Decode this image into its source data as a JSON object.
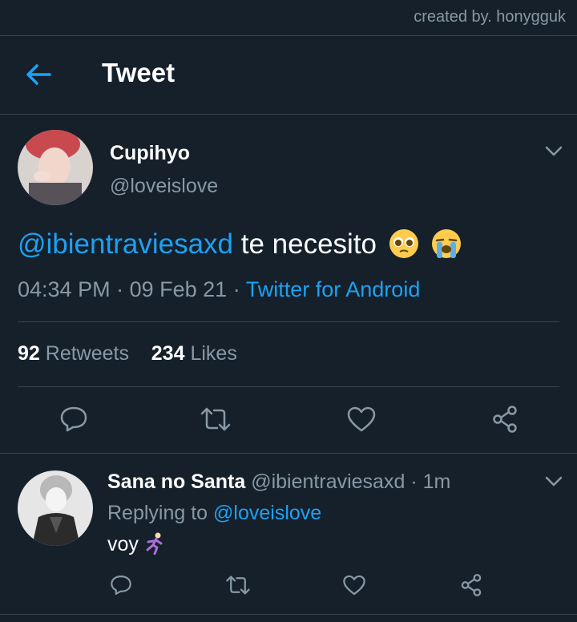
{
  "credit": "created by. honygguk",
  "header": {
    "title": "Tweet",
    "back_icon": "arrow-left-icon"
  },
  "tweet": {
    "author_name": "Cupihyo",
    "author_handle": "@loveislove",
    "mention": "@ibientraviesaxd",
    "text": "te necesito",
    "emojis": [
      "pleading-face-emoji",
      "loudly-crying-face-emoji"
    ],
    "time": "04:34 PM",
    "date": "09 Feb 21",
    "separator": "·",
    "source": "Twitter for Android",
    "retweets_count": "92",
    "retweets_label": "Retweets",
    "likes_count": "234",
    "likes_label": "Likes",
    "actions": [
      "reply-icon",
      "retweet-icon",
      "like-icon",
      "share-icon"
    ]
  },
  "reply": {
    "author_name": "Sana no Santa",
    "author_handle": "@ibientraviesaxd",
    "separator": "·",
    "time": "1m",
    "replying_label": "Replying to",
    "replying_to": "@loveislove",
    "text": "voy",
    "emoji": "person-running-emoji"
  },
  "colors": {
    "background": "#15202b",
    "accent": "#1da1f2",
    "muted": "#8899a6",
    "divider": "#38444d"
  }
}
